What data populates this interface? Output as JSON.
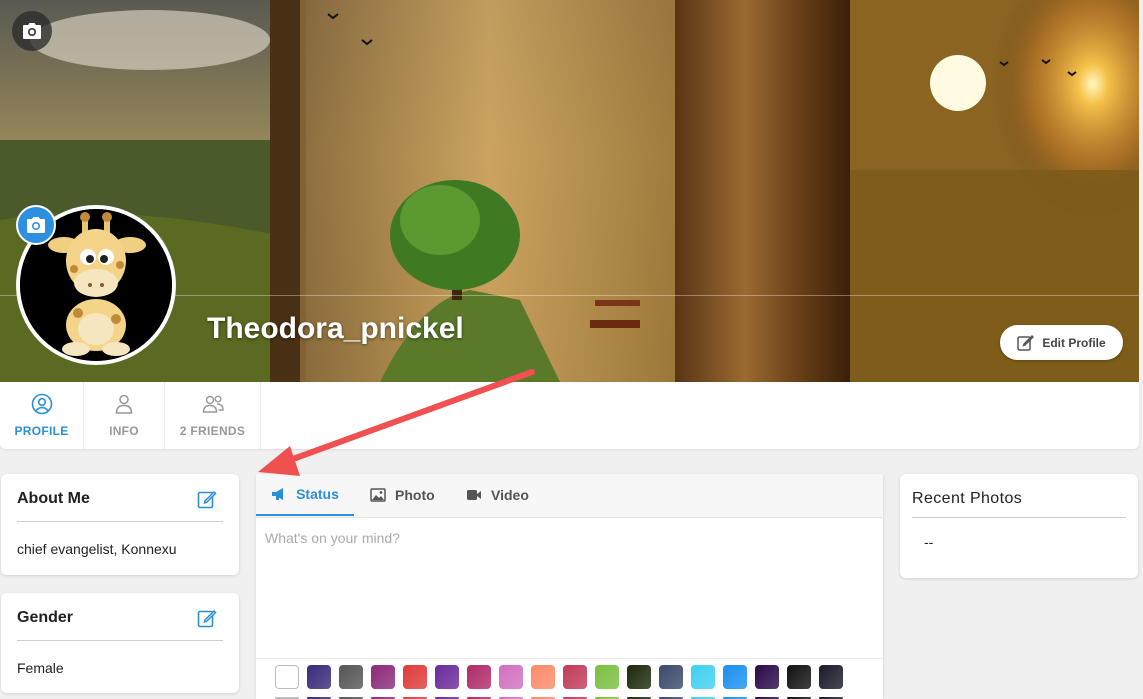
{
  "profile": {
    "username": "Theodora_pnickel",
    "edit_profile_label": "Edit Profile"
  },
  "nav": {
    "tabs": [
      {
        "label": "PROFILE",
        "active": true,
        "icon": "user-circle-icon"
      },
      {
        "label": "INFO",
        "active": false,
        "icon": "user-icon"
      },
      {
        "label": "2 FRIENDS",
        "active": false,
        "icon": "users-icon"
      }
    ]
  },
  "about": {
    "title": "About Me",
    "value": "chief evangelist, Konnexu"
  },
  "gender": {
    "title": "Gender",
    "value": "Female"
  },
  "composer": {
    "tabs": [
      {
        "label": "Status",
        "icon": "megaphone-icon",
        "active": true
      },
      {
        "label": "Photo",
        "icon": "image-icon",
        "active": false
      },
      {
        "label": "Video",
        "icon": "video-camera-icon",
        "active": false
      }
    ],
    "placeholder": "What's on your mind?",
    "background_swatches": [
      "#ffffff",
      "#3a2a7a",
      "#555555",
      "#8a2a7a",
      "#e03a3a",
      "#6a2a9a",
      "#b02a6a",
      "#d070c0",
      "#ff8a6a",
      "#c03a5a",
      "#7ac040",
      "#1a2a0a",
      "#3a4a6a",
      "#40d0f0",
      "#1a90f0",
      "#2a0a4a",
      "#111111",
      "#1a1a2a"
    ]
  },
  "recent_photos": {
    "title": "Recent Photos",
    "value": "--"
  },
  "colors": {
    "accent": "#2b8fd8",
    "annotation_arrow": "#f05050"
  }
}
